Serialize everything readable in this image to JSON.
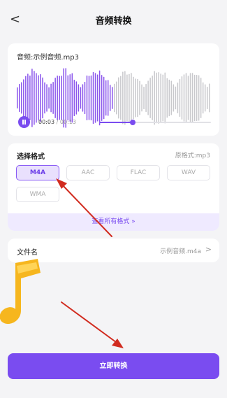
{
  "header": {
    "back_icon": "chevron-left-icon",
    "title": "音频转换"
  },
  "player": {
    "file_label": "音频:示例音频.mp3",
    "current_time": "00:03",
    "total_time": "00:13",
    "progress": 0.3
  },
  "format": {
    "title": "选择格式",
    "original": "原格式:mp3",
    "options": [
      "M4A",
      "AAC",
      "FLAC",
      "WAV",
      "WMA"
    ],
    "selected": "M4A",
    "show_all": "查看所有格式 »"
  },
  "filename": {
    "label": "文件名",
    "value": "示例音频.m4a",
    "chevron": ">"
  },
  "convert_button": "立即转换",
  "colors": {
    "accent": "#7a4cf0",
    "wave_played": "#8a55ec",
    "wave_unplayed": "#c8c8cc",
    "annotation_arrow": "#d12b1f",
    "note_icon": "#f6b61e"
  }
}
